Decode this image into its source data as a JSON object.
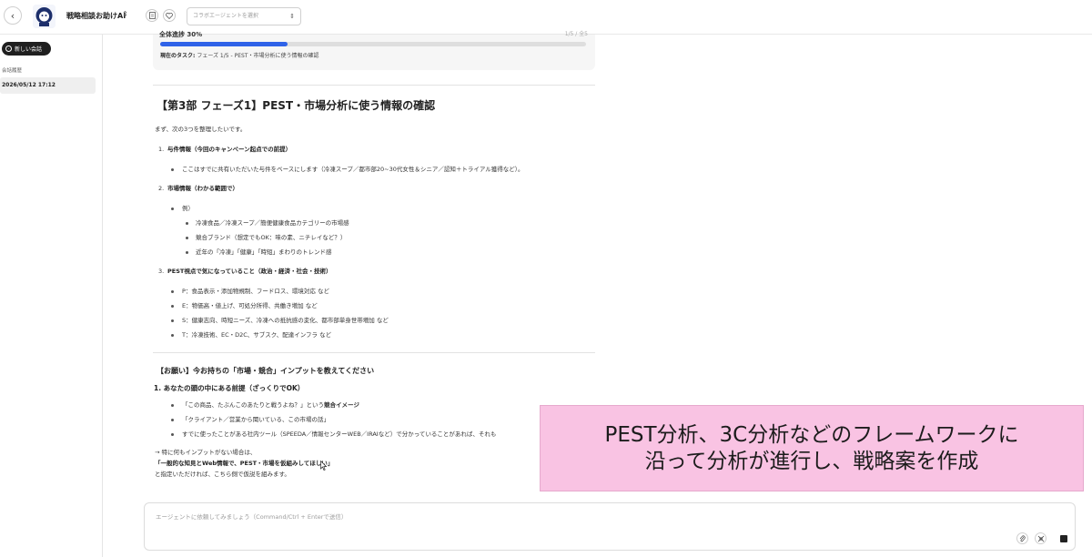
{
  "header": {
    "back_icon": "chevron-left-icon",
    "app_title": "戦略相談お助けAI",
    "title_chevron": "⌃⌄",
    "agent_select_placeholder": "コラボエージェントを選択"
  },
  "sidebar": {
    "new_chat_label": "新しい会話",
    "history_label": "会話履歴",
    "history_items": [
      "2026/05/12 17:12"
    ]
  },
  "progress": {
    "label": "全体進捗 30%",
    "right_text": "1/5 / 全5",
    "value_fraction": 0.3,
    "current_task_label": "現在のタスク:",
    "current_task_value": "フェーズ 1/5 - PEST・市場分析に使う情報の確認"
  },
  "message": {
    "section_title": "【第3部 フェーズ1】PEST・市場分析に使う情報の確認",
    "intro": "まず、次の3つを整理したいです。",
    "items": [
      {
        "num": "1.",
        "title": "与件情報（今回のキャンペーン起点での前提）",
        "bullets": [
          "ここはすでに共有いただいた与件をベースにします（冷凍スープ／都市部20~30代女性＆シニア／認知＋トライアル獲得など）。"
        ]
      },
      {
        "num": "2.",
        "title": "市場情報（わかる範囲で）",
        "bullets": [
          "例）"
        ],
        "sub_bullets": [
          "冷凍食品／冷凍スープ／簡便健康食品カテゴリーの市場感",
          "競合ブランド（想定でもOK：味の素、ニチレイなど？）",
          "近年の「冷凍」「健康」「時短」まわりのトレンド感"
        ]
      },
      {
        "num": "3.",
        "title": "PEST視点で気になっていること（政治・経済・社会・技術）",
        "bullets": [
          "P：食品表示・添加物規制、フードロス、環境対応 など",
          "E：物価高・値上げ、可処分所得、共働き増加 など",
          "S：健康志向、時短ニーズ、冷凍への抵抗感の変化、都市部単身世帯増加 など",
          "T：冷凍技術、EC・D2C、サブスク、配達インフラ など"
        ]
      }
    ],
    "request_title": "【お願い】今お持ちの「市場・競合」インプットを教えてください",
    "request_sub_title": "1. あなたの頭の中にある前提（ざっくりでOK）",
    "request_bullets": [
      {
        "normal": "「この商品、たぶんこのあたりと戦うよね？」という",
        "bold": "競合イメージ"
      },
      {
        "normal": "「クライアント／営業から聞いている、この市場の話」",
        "bold": ""
      },
      {
        "normal": "すでに使ったことがある社内ツール（SPEEDA／情報センターWEB／IRAIなど）で分かっていることがあれば、それも",
        "bold": ""
      }
    ],
    "fallback_line1": "→ 特に何もインプットがない場合は、",
    "fallback_line2": "「一般的な知見とWeb情報で、PEST・市場を仮組みしてほしい」",
    "fallback_line3": "と指定いただければ、こちら側で仮説を組みます。"
  },
  "input": {
    "placeholder": "エージェントに依頼してみましょう（Command/Ctrl + Enterで送信）"
  },
  "caption": {
    "line1": "PEST分析、3C分析などのフレームワークに",
    "line2": "沿って分析が進行し、戦略案を作成"
  },
  "colors": {
    "accent": "#2f63e8",
    "caption_bg": "#f9c3e3"
  }
}
